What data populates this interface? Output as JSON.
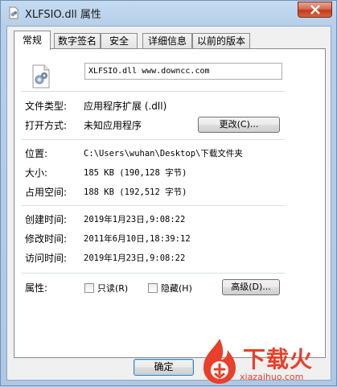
{
  "window": {
    "title": "XLFSIO.dll 属性"
  },
  "tabs": [
    {
      "label": "常规"
    },
    {
      "label": "数字签名"
    },
    {
      "label": "安全"
    },
    {
      "label": "详细信息"
    },
    {
      "label": "以前的版本"
    }
  ],
  "general": {
    "filename": "XLFSIO.dll www.downcc.com",
    "file_type_label": "文件类型:",
    "file_type_value": "应用程序扩展 (.dll)",
    "open_with_label": "打开方式:",
    "open_with_value": "未知应用程序",
    "change_button": "更改(C)...",
    "location_label": "位置:",
    "location_value": "C:\\Users\\wuhan\\Desktop\\下载文件夹",
    "size_label": "大小:",
    "size_value": "185 KB (190,128 字节)",
    "size_on_disk_label": "占用空间:",
    "size_on_disk_value": "188 KB (192,512 字节)",
    "created_label": "创建时间:",
    "created_value": "2019年1月23日,9:08:22",
    "modified_label": "修改时间:",
    "modified_value": "2011年6月10日,18:39:12",
    "accessed_label": "访问时间:",
    "accessed_value": "2019年1月23日,9:08:22",
    "attributes_label": "属性:",
    "readonly_label": "只读(R)",
    "readonly_checked": false,
    "hidden_label": "隐藏(H)",
    "hidden_checked": false,
    "advanced_button": "高级(D)..."
  },
  "footer": {
    "ok_button": "确定"
  },
  "watermark": {
    "brand": "下载火",
    "url": "xiazaihuo.com",
    "color": "#e8402a"
  }
}
